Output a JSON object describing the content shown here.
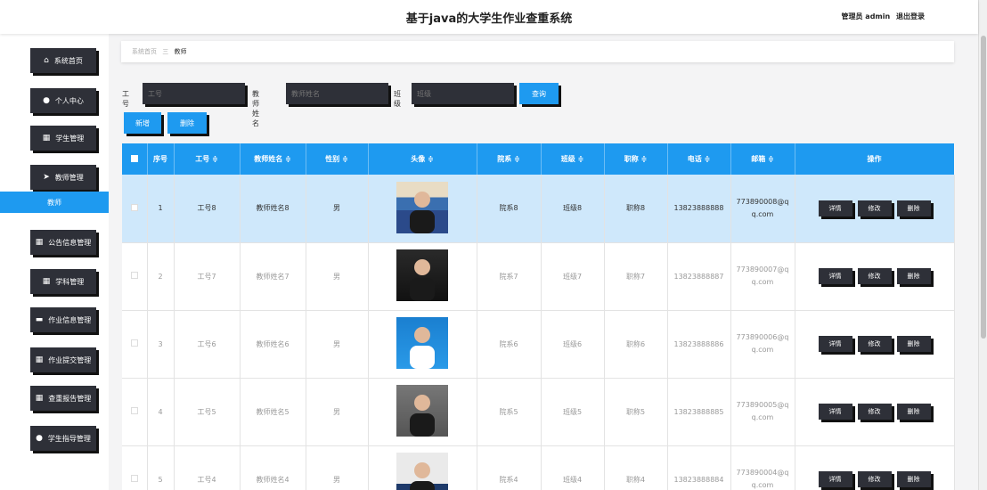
{
  "header": {
    "title": "基于java的大学生作业查重系统",
    "user_label": "管理员 admin",
    "logout_label": "退出登录"
  },
  "sidebar": {
    "items": [
      {
        "label": "系统首页",
        "icon": "home-icon"
      },
      {
        "label": "个人中心",
        "icon": "person-icon"
      },
      {
        "label": "学生管理",
        "icon": "grid-icon"
      },
      {
        "label": "教师管理",
        "icon": "send-icon"
      },
      {
        "label": "公告信息管理",
        "icon": "grid-icon"
      },
      {
        "label": "学科管理",
        "icon": "grid-icon"
      },
      {
        "label": "作业信息管理",
        "icon": "monitor-icon"
      },
      {
        "label": "作业提交管理",
        "icon": "grid-icon"
      },
      {
        "label": "查重报告管理",
        "icon": "grid-icon"
      },
      {
        "label": "学生指导管理",
        "icon": "person-icon"
      }
    ],
    "active_sub": "教师"
  },
  "breadcrumb": {
    "home": "系统首页",
    "separator": "三",
    "current": "教师"
  },
  "search": {
    "job_no_label": "工号",
    "job_no_placeholder": "工号",
    "name_label": "教师姓名",
    "name_placeholder": "教师姓名",
    "class_label": "班级",
    "class_placeholder": "班级",
    "query_button": "查询"
  },
  "actions": {
    "add": "新增",
    "delete": "删除"
  },
  "table": {
    "headers": [
      "序号",
      "工号 ≑",
      "教师姓名 ≑",
      "性别 ≑",
      "头像 ≑",
      "院系 ≑",
      "班级 ≑",
      "职称 ≑",
      "电话 ≑",
      "邮箱 ≑",
      "操作"
    ],
    "row_buttons": [
      "详情",
      "修改",
      "删除"
    ],
    "rows": [
      {
        "idx": "1",
        "job_no": "工号8",
        "name": "教师姓名8",
        "gender": "男",
        "dept": "院系8",
        "class": "班级8",
        "title": "职称8",
        "phone": "13823888888",
        "email": "773890008@qq.com"
      },
      {
        "idx": "2",
        "job_no": "工号7",
        "name": "教师姓名7",
        "gender": "男",
        "dept": "院系7",
        "class": "班级7",
        "title": "职称7",
        "phone": "13823888887",
        "email": "773890007@qq.com"
      },
      {
        "idx": "3",
        "job_no": "工号6",
        "name": "教师姓名6",
        "gender": "男",
        "dept": "院系6",
        "class": "班级6",
        "title": "职称6",
        "phone": "13823888886",
        "email": "773890006@qq.com"
      },
      {
        "idx": "4",
        "job_no": "工号5",
        "name": "教师姓名5",
        "gender": "男",
        "dept": "院系5",
        "class": "班级5",
        "title": "职称5",
        "phone": "13823888885",
        "email": "773890005@qq.com"
      },
      {
        "idx": "5",
        "job_no": "工号4",
        "name": "教师姓名4",
        "gender": "男",
        "dept": "院系4",
        "class": "班级4",
        "title": "职称4",
        "phone": "13823888884",
        "email": "773890004@qq.com"
      }
    ]
  },
  "colors": {
    "accent": "#1e9af0",
    "dark": "#2e3038",
    "selected_row": "#cfe8fb"
  }
}
